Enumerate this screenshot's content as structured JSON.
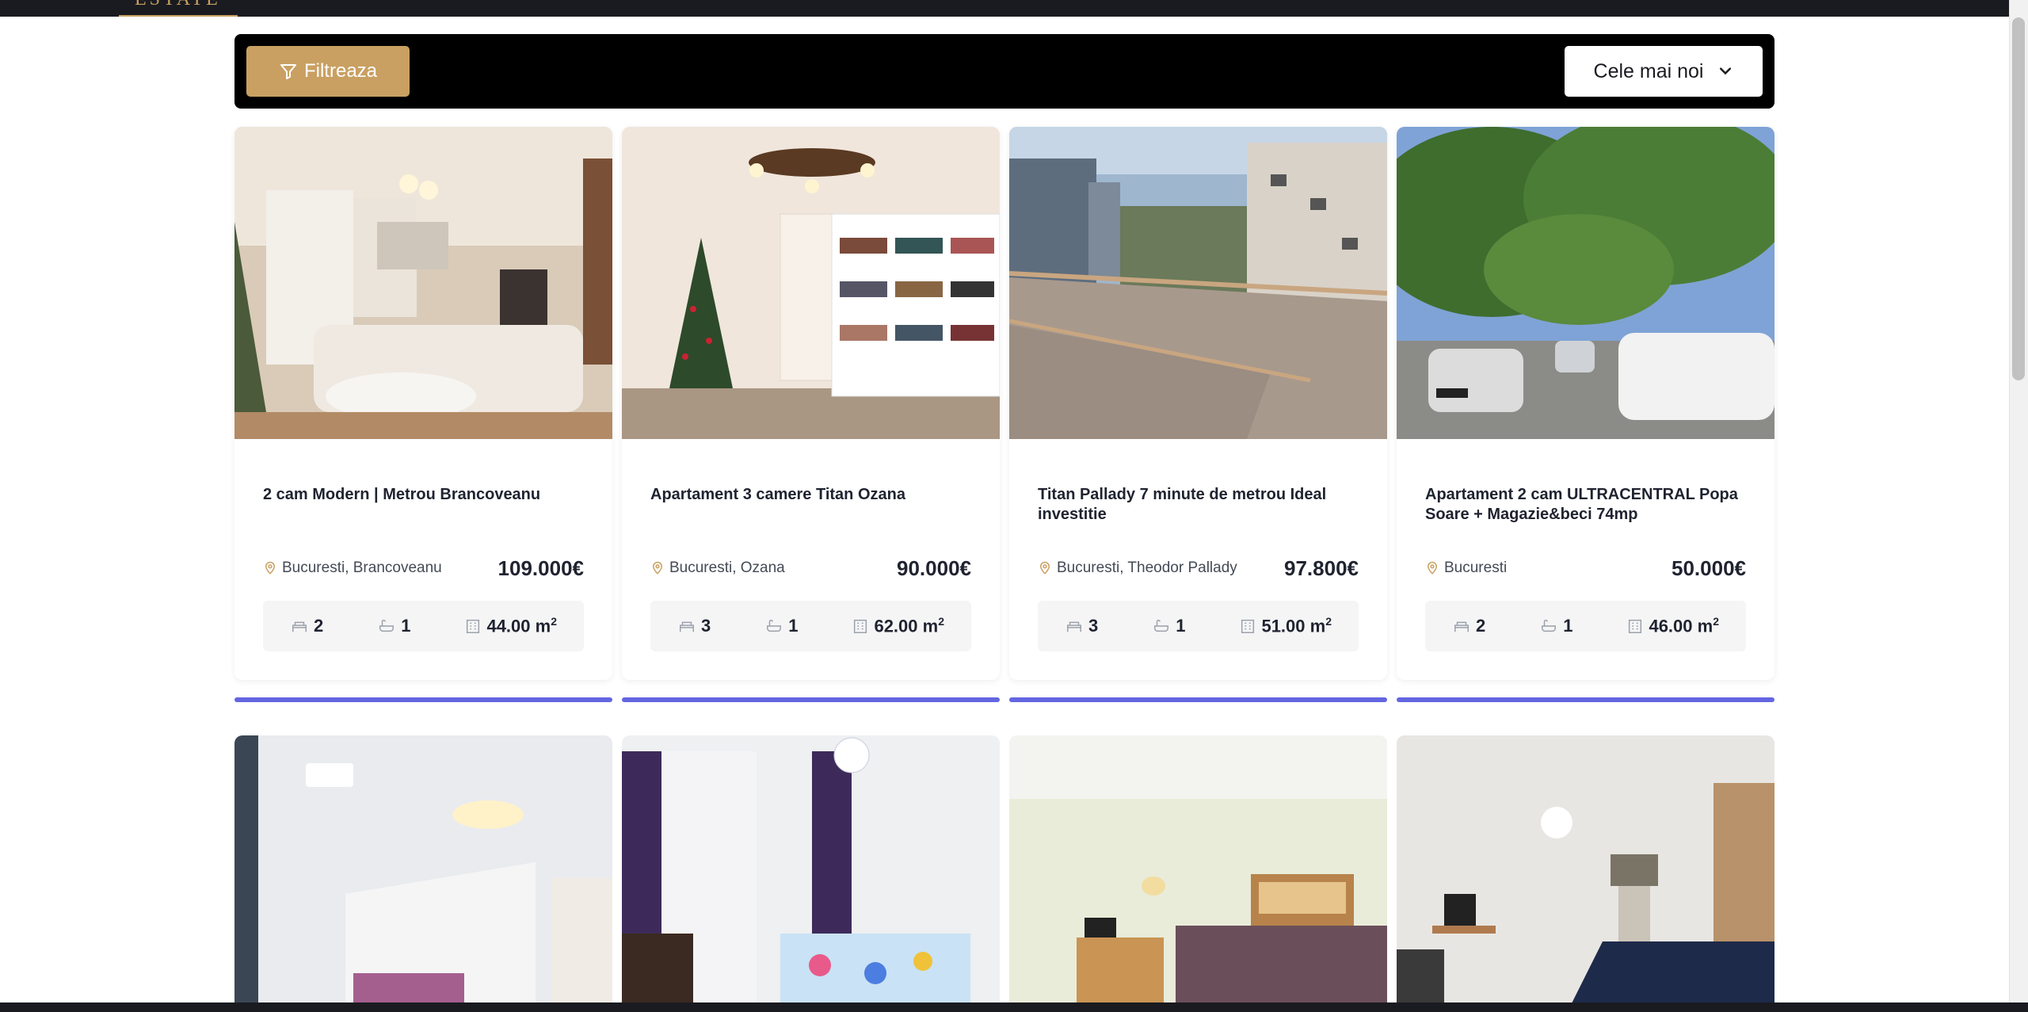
{
  "header": {
    "logo_fragment": "ESTATE"
  },
  "filter_bar": {
    "filter_label": "Filtreaza",
    "sort_label": "Cele mai noi"
  },
  "colors": {
    "accent_gold": "#c9a062",
    "accent_blue": "#6366e0",
    "dark": "#1a1b20"
  },
  "listings": [
    {
      "title": "2 cam Modern | Metrou Brancoveanu",
      "location": "Bucuresti, Brancoveanu",
      "price": "109.000€",
      "rooms": "2",
      "baths": "1",
      "area": "44.00 m",
      "area_sup": "2"
    },
    {
      "title": "Apartament 3 camere Titan Ozana",
      "location": "Bucuresti, Ozana",
      "price": "90.000€",
      "rooms": "3",
      "baths": "1",
      "area": "62.00 m",
      "area_sup": "2"
    },
    {
      "title": "Titan Pallady 7 minute de metrou Ideal investitie",
      "location": "Bucuresti, Theodor Pallady",
      "price": "97.800€",
      "rooms": "3",
      "baths": "1",
      "area": "51.00 m",
      "area_sup": "2"
    },
    {
      "title": "Apartament 2 cam ULTRACENTRAL Popa Soare + Magazie&beci 74mp",
      "location": "Bucuresti",
      "price": "50.000€",
      "rooms": "2",
      "baths": "1",
      "area": "46.00 m",
      "area_sup": "2"
    }
  ]
}
